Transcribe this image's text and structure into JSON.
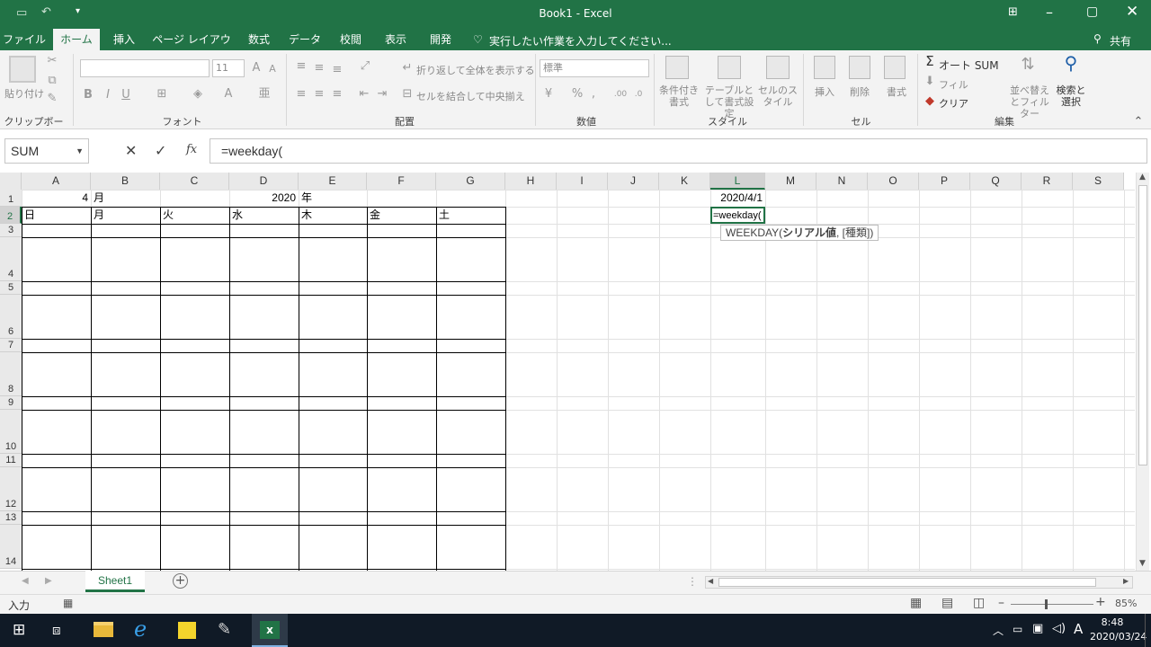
{
  "window": {
    "title": "Book1 - Excel"
  },
  "tabs": [
    "ファイル",
    "ホーム",
    "挿入",
    "ページ レイアウト",
    "数式",
    "データ",
    "校閲",
    "表示",
    "開発"
  ],
  "tell_me": "実行したい作業を入力してください...",
  "share": "共有",
  "ribbon": {
    "clipboard": {
      "paste": "貼り付け",
      "label": "クリップボード"
    },
    "font": {
      "size": "11",
      "bold": "B",
      "italic": "I",
      "underline": "U",
      "label": "フォント"
    },
    "alignment": {
      "wrap": "折り返して全体を表示する",
      "merge": "セルを結合して中央揃え",
      "label": "配置"
    },
    "number": {
      "format": "標準",
      "label": "数値"
    },
    "styles": {
      "conditional": "条件付き書式",
      "table": "テーブルとして書式設定",
      "cell": "セルのスタイル",
      "label": "スタイル"
    },
    "cells": {
      "insert": "挿入",
      "delete": "削除",
      "format": "書式",
      "label": "セル"
    },
    "editing": {
      "autosum": "オート SUM",
      "fill": "フィル",
      "clear": "クリア",
      "sort": "並べ替えとフィルター",
      "find": "検索と選択",
      "label": "編集"
    }
  },
  "formula_bar": {
    "name_box": "SUM",
    "formula": "=weekday("
  },
  "columns": [
    "A",
    "B",
    "C",
    "D",
    "E",
    "F",
    "G",
    "H",
    "I",
    "J",
    "K",
    "L",
    "M",
    "N",
    "O",
    "P",
    "Q",
    "R",
    "S"
  ],
  "rows": [
    "1",
    "2",
    "3",
    "4",
    "5",
    "6",
    "7",
    "8",
    "9",
    "10",
    "11",
    "12",
    "13",
    "14"
  ],
  "cells": {
    "A1": "4",
    "B1": "月",
    "D1": "2020",
    "E1": "年",
    "A2": "日",
    "B2": "月",
    "C2": "火",
    "D2": "水",
    "E2": "木",
    "F2": "金",
    "G2": "土",
    "L1": "2020/4/1",
    "L2": "=weekday("
  },
  "tooltip": {
    "func": "WEEKDAY(",
    "arg1": "シリアル値",
    "rest": ", [種類])"
  },
  "sheet": {
    "tab": "Sheet1"
  },
  "status": {
    "mode": "入力",
    "zoom": "85%"
  },
  "taskbar": {
    "time": "8:48",
    "date": "2020/03/24",
    "ime": "A"
  }
}
